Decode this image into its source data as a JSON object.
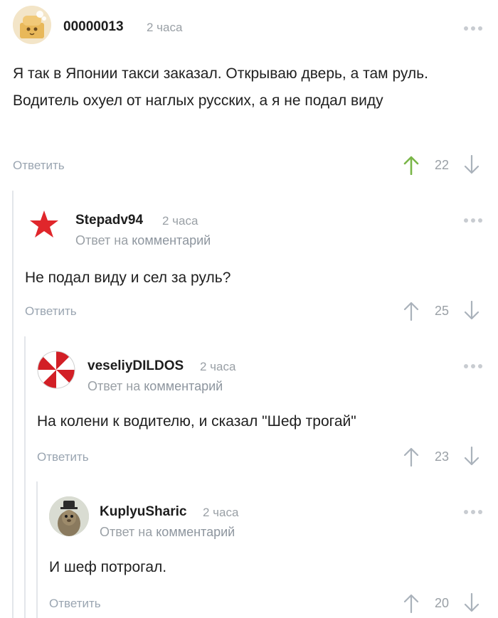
{
  "comments": [
    {
      "author": "00000013",
      "time": "2 часа",
      "text": "Я так в Японии такси заказал. Открываю дверь, а там руль. Водитель охуел от наглых русских, а я не подал виду",
      "reply_label": "Ответить",
      "rating": "22",
      "upvoted": true
    },
    {
      "author": "Stepadv94",
      "time": "2 часа",
      "reply_prefix": "Ответ на",
      "reply_target": "комментарий",
      "text": "Не подал виду и сел за руль?",
      "reply_label": "Ответить",
      "rating": "25"
    },
    {
      "author": "veseliyDILDOS",
      "time": "2 часа",
      "reply_prefix": "Ответ на",
      "reply_target": "комментарий",
      "text": "На колени к водителю, и сказал \"Шеф трогай\"",
      "reply_label": "Ответить",
      "rating": "23"
    },
    {
      "author": "KuplyuSharic",
      "time": "2 часа",
      "reply_prefix": "Ответ на",
      "reply_target": "комментарий",
      "text": "И шеф потрогал.",
      "reply_label": "Ответить",
      "rating": "20"
    }
  ],
  "colors": {
    "upvote_active": "#7ab648",
    "arrow_inactive": "#aab2bb",
    "thread_line": "#e3e6ea"
  }
}
